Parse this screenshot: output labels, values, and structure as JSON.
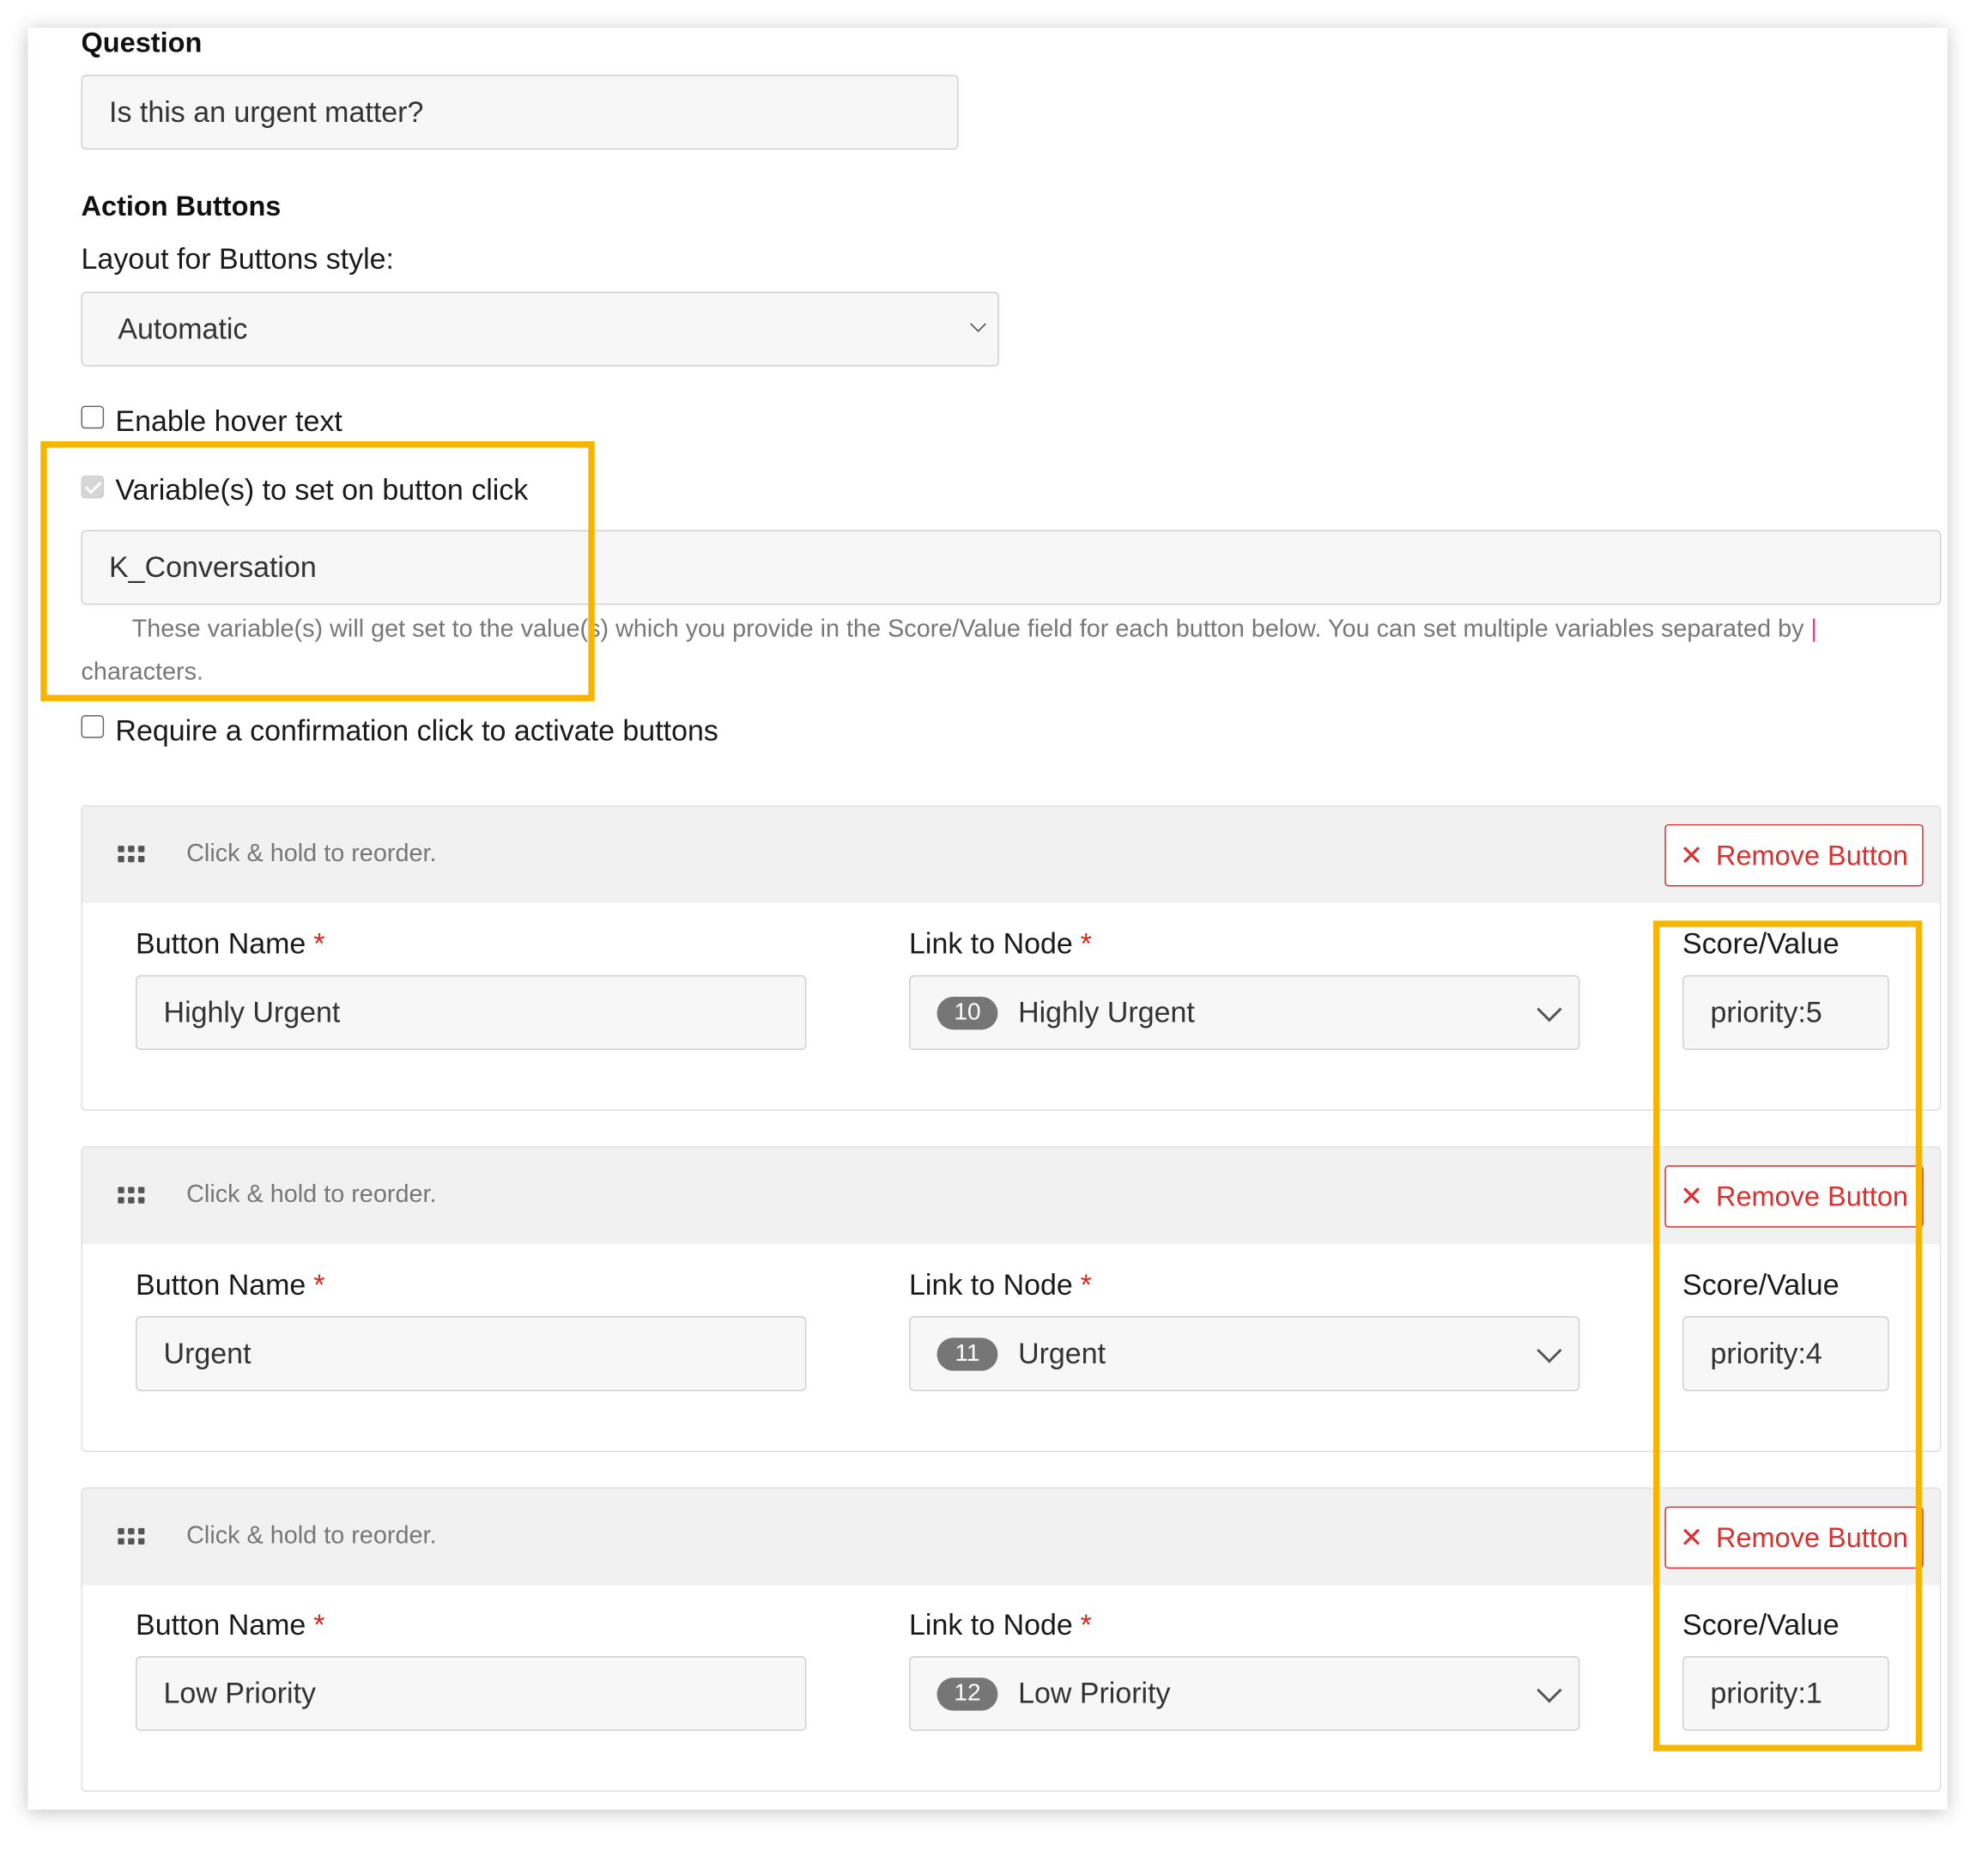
{
  "question": {
    "label": "Question",
    "value": "Is this an urgent matter?"
  },
  "action_buttons": {
    "heading": "Action Buttons",
    "layout_label": "Layout for Buttons style:",
    "layout_value": "Automatic"
  },
  "options": {
    "hover_text_label": "Enable hover text",
    "hover_text_checked": false,
    "variables_label": "Variable(s) to set on button click",
    "variables_checked": true,
    "variables_value": "K_Conversation",
    "variables_help": "These variable(s) will get set to the value(s) which you provide in the Score/Value field for each button below. You can set multiple variables separated by",
    "variables_help_pipe": "|",
    "variables_help_end": "characters.",
    "confirm_label": "Require a confirmation click to activate buttons",
    "confirm_checked": false
  },
  "panel_labels": {
    "reorder_hint": "Click & hold to reorder.",
    "remove_button": "Remove Button",
    "button_name_label": "Button Name",
    "link_to_node_label": "Link to Node",
    "score_value_label": "Score/Value",
    "required_mark": "*"
  },
  "buttons": [
    {
      "name": "Highly Urgent",
      "node_id": "10",
      "node_name": "Highly Urgent",
      "score": "priority:5"
    },
    {
      "name": "Urgent",
      "node_id": "11",
      "node_name": "Urgent",
      "score": "priority:4"
    },
    {
      "name": "Low Priority",
      "node_id": "12",
      "node_name": "Low Priority",
      "score": "priority:1"
    }
  ],
  "colors": {
    "highlight": "#f7b500",
    "danger": "#d93030",
    "badge": "#767676"
  }
}
